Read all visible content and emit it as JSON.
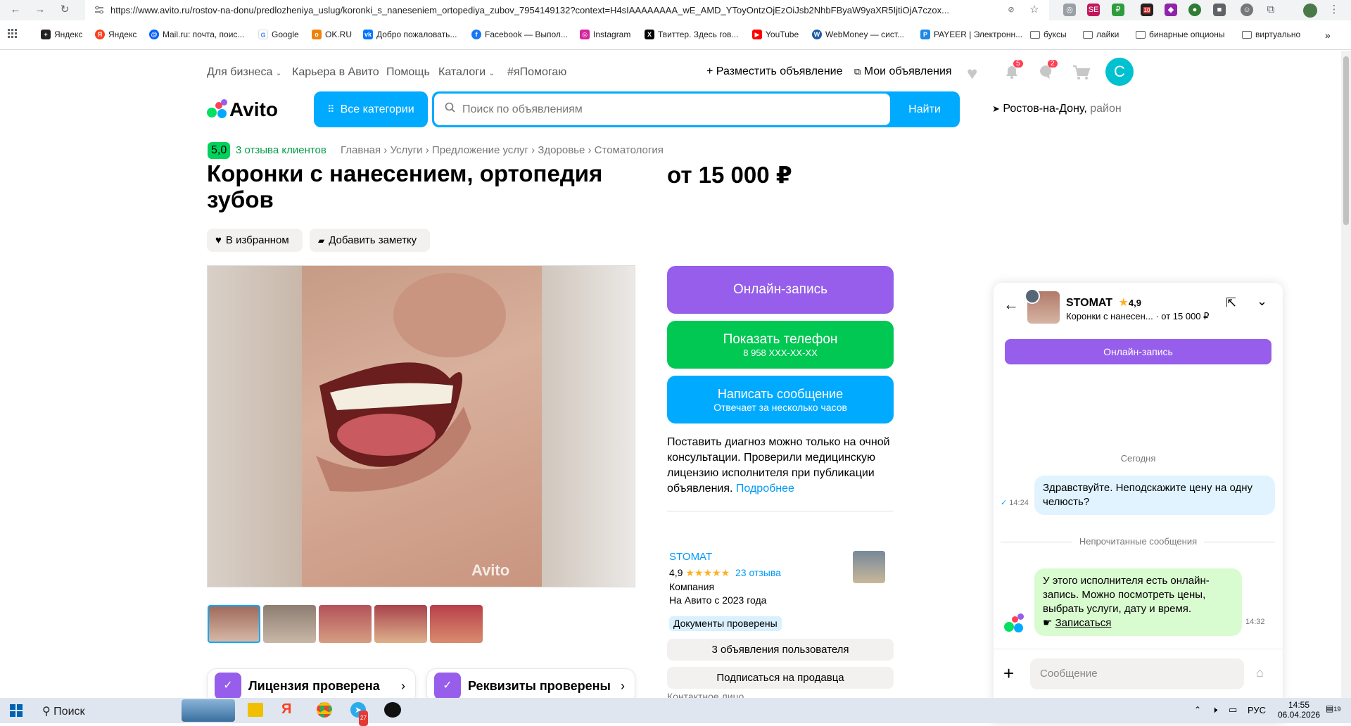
{
  "browser": {
    "url": "https://www.avito.ru/rostov-na-donu/predlozheniya_uslug/koronki_s_naneseniem_ortopediya_zubov_7954149132?context=H4sIAAAAAAAA_wE_AMD_YToyOntzOjEzOiJsb2NhbFByaW9yaXR5IjtiOjA7czox...",
    "bookmarks": [
      "Яндекс",
      "Яндекс",
      "Mail.ru: почта, поис...",
      "Google",
      "OK.RU",
      "Добро пожаловать...",
      "Facebook — Выпол...",
      "Instagram",
      "Твиттер. Здесь гов...",
      "YouTube",
      "WebMoney — сист...",
      "PAYEER | Электронн...",
      "буксы",
      "лайки",
      "бинарные опционы",
      "виртуально"
    ],
    "ext_badge": "10",
    "more_bm": "»"
  },
  "header": {
    "nav": [
      "Для бизнеса",
      "Карьера в Авито",
      "Помощь",
      "Каталоги",
      "#яПомогаю"
    ],
    "post_ad": "Разместить объявление",
    "my_ads": "Мои объявления",
    "notif_count": "5",
    "msg_count": "2",
    "avatar_letter": "С",
    "logo_text": "Avito",
    "all_categories": "Все категории",
    "search_placeholder": "Поиск по объявлениям",
    "find": "Найти",
    "city": "Ростов-на-Дону,",
    "district": "район"
  },
  "listing": {
    "rating": "5,0",
    "reviews": "3 отзыва клиентов",
    "breadcrumb": [
      "Главная",
      "Услуги",
      "Предложение услуг",
      "Здоровье",
      "Стоматология"
    ],
    "title": "Коронки с нанесением, ортопедия зубов",
    "price": "от 15 000 ₽",
    "favorite": "В избранном",
    "add_note": "Добавить заметку",
    "watermark": "Avito"
  },
  "actions": {
    "online_booking": "Онлайн-запись",
    "show_phone": "Показать телефон",
    "phone_mask": "8 958 XXX-XX-XX",
    "write_message": "Написать сообщение",
    "reply_time": "Отвечает за несколько часов",
    "disclaimer": "Поставить диагноз можно только на очной консультации. Проверили медицинскую лицензию исполнителя при публикации объявления.",
    "more": "Подробнее"
  },
  "seller": {
    "name": "STOMAT",
    "rating": "4,9",
    "stars": "★★★★★",
    "reviews": "23 отзыва",
    "type": "Компания",
    "since": "На Авито с 2023 года",
    "docs": "Документы проверены",
    "ads_count": "3 объявления пользователя",
    "subscribe": "Подписаться на продавца",
    "contact": "Контактное лицо"
  },
  "cards": {
    "license": "Лицензия проверена",
    "requisites": "Реквизиты проверены"
  },
  "chat": {
    "seller": "STOMAT",
    "rating": "4,9",
    "item": "Коронки с нанесен...",
    "price": "· от 15 000 ₽",
    "booking": "Онлайн-запись",
    "today": "Сегодня",
    "msg1": "Здравствуйте. Неподскажите цену на одну челюсть?",
    "msg1_time": "14:24",
    "unread": "Непрочитанные сообщения",
    "msg2": "У этого исполнителя есть онлайн-запись. Можно посмотреть цены, выбрать услуги, дату и время.",
    "msg2_link": "Записаться",
    "msg2_time": "14:32",
    "input_placeholder": "Сообщение"
  },
  "taskbar": {
    "search": "Поиск",
    "lang": "РУС",
    "time": "14:55",
    "date": "06.04.2026",
    "notif": "19",
    "tg_badge": "27"
  }
}
